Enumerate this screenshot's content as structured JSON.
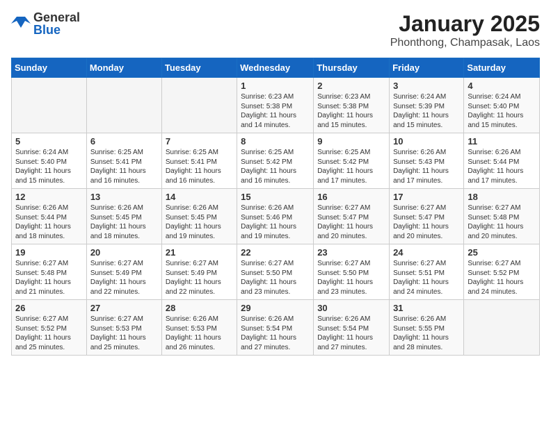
{
  "logo": {
    "general": "General",
    "blue": "Blue"
  },
  "title": "January 2025",
  "subtitle": "Phonthong, Champasak, Laos",
  "weekdays": [
    "Sunday",
    "Monday",
    "Tuesday",
    "Wednesday",
    "Thursday",
    "Friday",
    "Saturday"
  ],
  "weeks": [
    [
      {
        "day": "",
        "content": ""
      },
      {
        "day": "",
        "content": ""
      },
      {
        "day": "",
        "content": ""
      },
      {
        "day": "1",
        "content": "Sunrise: 6:23 AM\nSunset: 5:38 PM\nDaylight: 11 hours and 14 minutes."
      },
      {
        "day": "2",
        "content": "Sunrise: 6:23 AM\nSunset: 5:38 PM\nDaylight: 11 hours and 15 minutes."
      },
      {
        "day": "3",
        "content": "Sunrise: 6:24 AM\nSunset: 5:39 PM\nDaylight: 11 hours and 15 minutes."
      },
      {
        "day": "4",
        "content": "Sunrise: 6:24 AM\nSunset: 5:40 PM\nDaylight: 11 hours and 15 minutes."
      }
    ],
    [
      {
        "day": "5",
        "content": "Sunrise: 6:24 AM\nSunset: 5:40 PM\nDaylight: 11 hours and 15 minutes."
      },
      {
        "day": "6",
        "content": "Sunrise: 6:25 AM\nSunset: 5:41 PM\nDaylight: 11 hours and 16 minutes."
      },
      {
        "day": "7",
        "content": "Sunrise: 6:25 AM\nSunset: 5:41 PM\nDaylight: 11 hours and 16 minutes."
      },
      {
        "day": "8",
        "content": "Sunrise: 6:25 AM\nSunset: 5:42 PM\nDaylight: 11 hours and 16 minutes."
      },
      {
        "day": "9",
        "content": "Sunrise: 6:25 AM\nSunset: 5:42 PM\nDaylight: 11 hours and 17 minutes."
      },
      {
        "day": "10",
        "content": "Sunrise: 6:26 AM\nSunset: 5:43 PM\nDaylight: 11 hours and 17 minutes."
      },
      {
        "day": "11",
        "content": "Sunrise: 6:26 AM\nSunset: 5:44 PM\nDaylight: 11 hours and 17 minutes."
      }
    ],
    [
      {
        "day": "12",
        "content": "Sunrise: 6:26 AM\nSunset: 5:44 PM\nDaylight: 11 hours and 18 minutes."
      },
      {
        "day": "13",
        "content": "Sunrise: 6:26 AM\nSunset: 5:45 PM\nDaylight: 11 hours and 18 minutes."
      },
      {
        "day": "14",
        "content": "Sunrise: 6:26 AM\nSunset: 5:45 PM\nDaylight: 11 hours and 19 minutes."
      },
      {
        "day": "15",
        "content": "Sunrise: 6:26 AM\nSunset: 5:46 PM\nDaylight: 11 hours and 19 minutes."
      },
      {
        "day": "16",
        "content": "Sunrise: 6:27 AM\nSunset: 5:47 PM\nDaylight: 11 hours and 20 minutes."
      },
      {
        "day": "17",
        "content": "Sunrise: 6:27 AM\nSunset: 5:47 PM\nDaylight: 11 hours and 20 minutes."
      },
      {
        "day": "18",
        "content": "Sunrise: 6:27 AM\nSunset: 5:48 PM\nDaylight: 11 hours and 20 minutes."
      }
    ],
    [
      {
        "day": "19",
        "content": "Sunrise: 6:27 AM\nSunset: 5:48 PM\nDaylight: 11 hours and 21 minutes."
      },
      {
        "day": "20",
        "content": "Sunrise: 6:27 AM\nSunset: 5:49 PM\nDaylight: 11 hours and 22 minutes."
      },
      {
        "day": "21",
        "content": "Sunrise: 6:27 AM\nSunset: 5:49 PM\nDaylight: 11 hours and 22 minutes."
      },
      {
        "day": "22",
        "content": "Sunrise: 6:27 AM\nSunset: 5:50 PM\nDaylight: 11 hours and 23 minutes."
      },
      {
        "day": "23",
        "content": "Sunrise: 6:27 AM\nSunset: 5:50 PM\nDaylight: 11 hours and 23 minutes."
      },
      {
        "day": "24",
        "content": "Sunrise: 6:27 AM\nSunset: 5:51 PM\nDaylight: 11 hours and 24 minutes."
      },
      {
        "day": "25",
        "content": "Sunrise: 6:27 AM\nSunset: 5:52 PM\nDaylight: 11 hours and 24 minutes."
      }
    ],
    [
      {
        "day": "26",
        "content": "Sunrise: 6:27 AM\nSunset: 5:52 PM\nDaylight: 11 hours and 25 minutes."
      },
      {
        "day": "27",
        "content": "Sunrise: 6:27 AM\nSunset: 5:53 PM\nDaylight: 11 hours and 25 minutes."
      },
      {
        "day": "28",
        "content": "Sunrise: 6:26 AM\nSunset: 5:53 PM\nDaylight: 11 hours and 26 minutes."
      },
      {
        "day": "29",
        "content": "Sunrise: 6:26 AM\nSunset: 5:54 PM\nDaylight: 11 hours and 27 minutes."
      },
      {
        "day": "30",
        "content": "Sunrise: 6:26 AM\nSunset: 5:54 PM\nDaylight: 11 hours and 27 minutes."
      },
      {
        "day": "31",
        "content": "Sunrise: 6:26 AM\nSunset: 5:55 PM\nDaylight: 11 hours and 28 minutes."
      },
      {
        "day": "",
        "content": ""
      }
    ]
  ]
}
